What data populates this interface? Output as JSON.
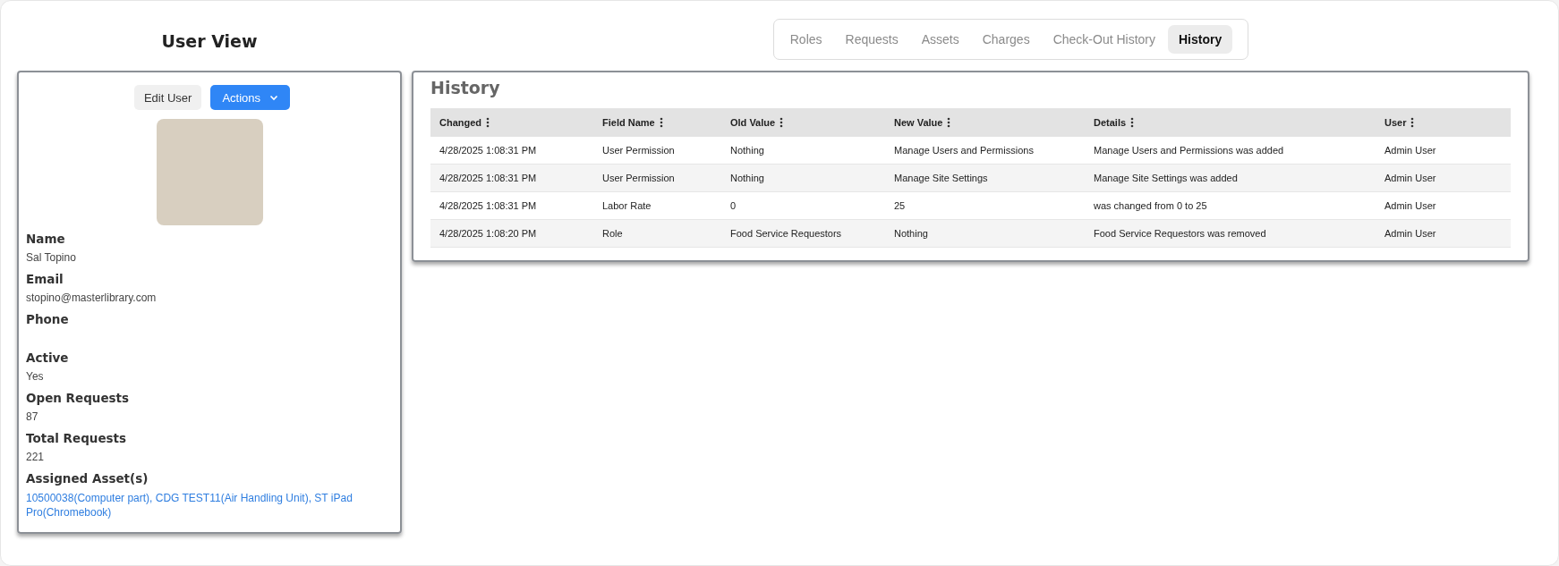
{
  "page_title": "User View",
  "tabs": [
    {
      "label": "Roles",
      "selected": false
    },
    {
      "label": "Requests",
      "selected": false
    },
    {
      "label": "Assets",
      "selected": false
    },
    {
      "label": "Charges",
      "selected": false
    },
    {
      "label": "Check-Out History",
      "selected": false
    },
    {
      "label": "History",
      "selected": true
    }
  ],
  "user_card": {
    "buttons": [
      {
        "label": "Edit User",
        "kind": "plain"
      },
      {
        "label": "Actions",
        "kind": "dropdown"
      }
    ],
    "fields": [
      {
        "label": "Name",
        "value": "Sal Topino"
      },
      {
        "label": "Email",
        "value": "stopino@masterlibrary.com"
      },
      {
        "label": "Phone"
      },
      {
        "label": "Active",
        "value": "Yes"
      },
      {
        "label": "Open Requests",
        "value": "87"
      },
      {
        "label": "Total Requests",
        "value": "221"
      },
      {
        "label": "Assigned Asset(s)",
        "links": "10500038(Computer part), CDG TEST11(Air Handling Unit), ST iPad Pro(Chromebook)"
      }
    ]
  },
  "history": {
    "title": "History",
    "columns": [
      "Changed",
      "Field Name",
      "Old Value",
      "New Value",
      "Details",
      "User"
    ],
    "rows": [
      [
        "4/28/2025 1:08:31 PM",
        "User Permission",
        "Nothing",
        "Manage Users and Permissions",
        "Manage Users and Permissions was added",
        "Admin User"
      ],
      [
        "4/28/2025 1:08:31 PM",
        "User Permission",
        "Nothing",
        "Manage Site Settings",
        "Manage Site Settings was added",
        "Admin User"
      ],
      [
        "4/28/2025 1:08:31 PM",
        "Labor Rate",
        "0",
        "25",
        "was changed from 0 to 25",
        "Admin User"
      ],
      [
        "4/28/2025 1:08:20 PM",
        "Role",
        "Food Service Requestors",
        "Nothing",
        "Food Service Requestors was removed",
        "Admin User"
      ]
    ]
  }
}
